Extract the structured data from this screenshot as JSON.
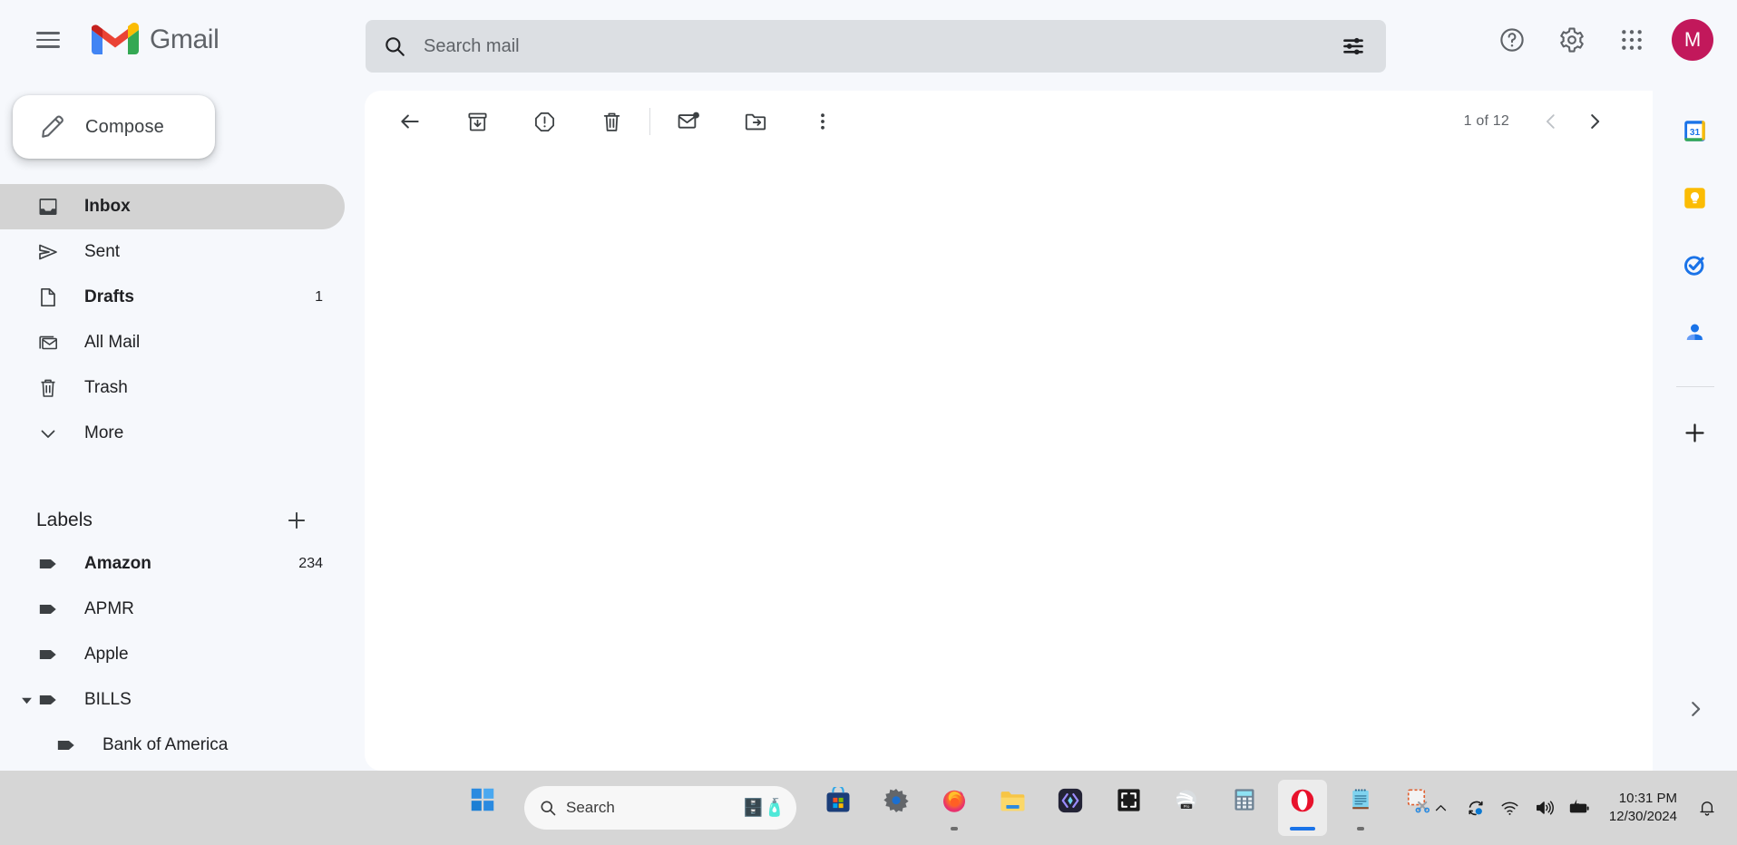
{
  "app": {
    "brand_name": "Gmail",
    "accent_avatar_color": "#c2185b",
    "avatar_initial": "M"
  },
  "topbar": {
    "menu_label": "Main menu",
    "search": {
      "placeholder": "Search mail",
      "value": "",
      "icon": "search-icon",
      "options_icon": "tune-icon"
    },
    "actions": [
      {
        "name": "support-icon",
        "label": "Support"
      },
      {
        "name": "settings-gear-icon",
        "label": "Settings"
      },
      {
        "name": "google-apps-grid-icon",
        "label": "Google apps"
      }
    ]
  },
  "sidebar": {
    "compose": {
      "label": "Compose",
      "icon": "pencil-icon"
    },
    "nav": [
      {
        "label": "Inbox",
        "icon": "inbox-icon",
        "count": "",
        "active": true,
        "bold": true
      },
      {
        "label": "Sent",
        "icon": "send-icon",
        "count": "",
        "active": false,
        "bold": false
      },
      {
        "label": "Drafts",
        "icon": "draft-icon",
        "count": "1",
        "active": false,
        "bold": true
      },
      {
        "label": "All Mail",
        "icon": "allmail-icon",
        "count": "",
        "active": false,
        "bold": false
      },
      {
        "label": "Trash",
        "icon": "trash-icon",
        "count": "",
        "active": false,
        "bold": false
      },
      {
        "label": "More",
        "icon": "chevron-down-icon",
        "count": "",
        "active": false,
        "bold": false
      }
    ],
    "labels_header": {
      "title": "Labels",
      "add_label": "Create new label",
      "add_icon": "plus-icon"
    },
    "labels": [
      {
        "label": "Amazon",
        "count": "234",
        "bold": true,
        "expandable": false,
        "nested": false
      },
      {
        "label": "APMR",
        "count": "",
        "bold": false,
        "expandable": false,
        "nested": false
      },
      {
        "label": "Apple",
        "count": "",
        "bold": false,
        "expandable": false,
        "nested": false
      },
      {
        "label": "BILLS",
        "count": "",
        "bold": false,
        "expandable": true,
        "nested": false
      },
      {
        "label": "Bank of America",
        "count": "",
        "bold": false,
        "expandable": false,
        "nested": true
      }
    ]
  },
  "main": {
    "toolbar": [
      {
        "name": "back-to-inbox-button",
        "icon": "arrow-left-icon",
        "label": "Back to Inbox"
      },
      {
        "name": "archive-button",
        "icon": "archive-icon",
        "label": "Archive"
      },
      {
        "name": "report-spam-button",
        "icon": "report-spam-icon",
        "label": "Report spam"
      },
      {
        "name": "delete-button",
        "icon": "trash-icon",
        "label": "Delete"
      },
      {
        "name": "mark-unread-button",
        "icon": "mark-unread-icon",
        "label": "Mark as unread"
      },
      {
        "name": "move-to-button",
        "icon": "move-to-folder-icon",
        "label": "Move to"
      },
      {
        "name": "more-options-button",
        "icon": "more-vert-icon",
        "label": "More"
      }
    ],
    "pagination": {
      "range_text": "1 of 12",
      "prev_label": "Newer",
      "next_label": "Older",
      "prev_enabled": false,
      "next_enabled": true
    }
  },
  "side_rail": {
    "items": [
      {
        "name": "google-calendar-icon",
        "label": "Calendar"
      },
      {
        "name": "google-keep-icon",
        "label": "Keep"
      },
      {
        "name": "google-tasks-icon",
        "label": "Tasks"
      },
      {
        "name": "google-contacts-icon",
        "label": "Contacts"
      }
    ],
    "add": {
      "name": "plus-icon",
      "label": "Get add-ons"
    },
    "expand": {
      "name": "chevron-right-icon",
      "label": "Show side panel"
    }
  },
  "taskbar": {
    "start": {
      "name": "windows-start-icon",
      "label": "Start"
    },
    "search": {
      "placeholder": "Search",
      "value": "",
      "icon": "search-icon"
    },
    "apps": [
      {
        "name": "microsoft-store-icon",
        "label": "Microsoft Store",
        "active": false,
        "running": false
      },
      {
        "name": "settings-gear-icon",
        "label": "Settings",
        "active": false,
        "running": false
      },
      {
        "name": "firefox-icon",
        "label": "Firefox",
        "active": false,
        "running": true
      },
      {
        "name": "file-explorer-icon",
        "label": "File Explorer",
        "active": false,
        "running": false
      },
      {
        "name": "dark-app-icon",
        "label": "App",
        "active": false,
        "running": false
      },
      {
        "name": "snipping-frame-icon",
        "label": "Snipping Tool",
        "active": false,
        "running": false
      },
      {
        "name": "google-earth-pro-icon",
        "label": "Google Earth Pro",
        "active": false,
        "running": false
      },
      {
        "name": "calculator-icon",
        "label": "Calculator",
        "active": false,
        "running": false
      },
      {
        "name": "opera-icon",
        "label": "Opera",
        "active": true,
        "running": true
      },
      {
        "name": "notepad-icon",
        "label": "Notepad",
        "active": false,
        "running": true
      },
      {
        "name": "screen-snip-icon",
        "label": "Screen Snip",
        "active": false,
        "running": false
      }
    ],
    "tray": {
      "overflow": {
        "name": "chevron-up-icon",
        "label": "Show hidden icons"
      },
      "onedrive": {
        "name": "onedrive-sync-icon",
        "label": "OneDrive"
      },
      "wifi": {
        "name": "wifi-icon",
        "label": "Network"
      },
      "volume": {
        "name": "volume-icon",
        "label": "Volume"
      },
      "battery": {
        "name": "battery-charging-icon",
        "label": "Battery"
      },
      "time": "10:31 PM",
      "date": "12/30/2024",
      "notifications": {
        "name": "bell-icon",
        "label": "Notifications"
      }
    }
  }
}
